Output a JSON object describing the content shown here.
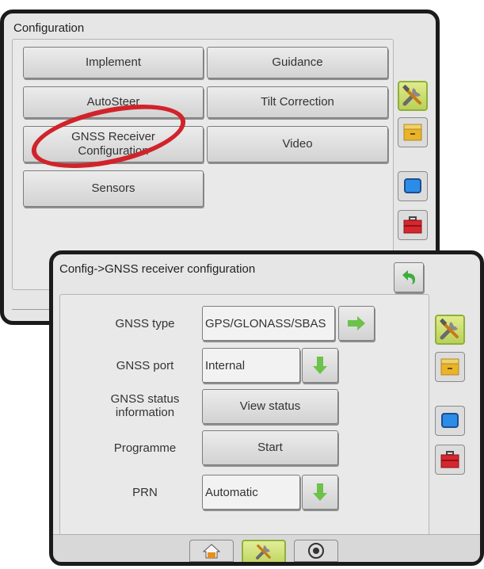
{
  "config_screen": {
    "title": "Configuration",
    "buttons": {
      "implement": "Implement",
      "guidance": "Guidance",
      "autosteer": "AutoSteer",
      "tilt_correction": "Tilt Correction",
      "gnss_line1": "GNSS Receiver",
      "gnss_line2": "Configuration",
      "video": "Video",
      "sensors": "Sensors"
    },
    "side_tabs": [
      "tools-icon",
      "folder-icon",
      "display-icon",
      "toolbox-icon"
    ],
    "active_tab": "tools-icon"
  },
  "gnss_screen": {
    "title": "Config->GNSS receiver configuration",
    "rows": {
      "gnss_type": {
        "label": "GNSS type",
        "value": "GPS/GLONASS/SBAS"
      },
      "gnss_port": {
        "label": "GNSS port",
        "value": "Internal"
      },
      "gnss_status": {
        "label_line1": "GNSS status",
        "label_line2": "information",
        "button": "View status"
      },
      "programme": {
        "label": "Programme",
        "button": "Start"
      },
      "prn": {
        "label": "PRN",
        "value": "Automatic"
      }
    },
    "bottom_tabs": [
      "home-icon",
      "tools-icon",
      "gauge-icon"
    ],
    "active_bottom_tab": "tools-icon"
  },
  "colors": {
    "highlight_ring": "#d1232a",
    "active_tab": "#c2d766",
    "arrow_green": "#6cc24a"
  }
}
